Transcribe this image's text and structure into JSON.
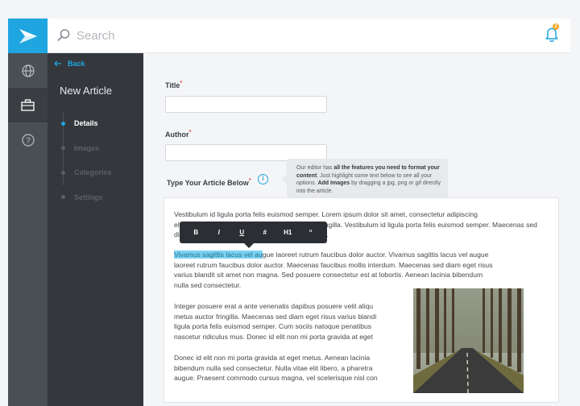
{
  "search": {
    "placeholder": "Search"
  },
  "notifications": {
    "count": "2"
  },
  "sidebar": {
    "back_label": "Back",
    "title": "New Article",
    "steps": [
      {
        "label": "Details",
        "active": true
      },
      {
        "label": "Images",
        "active": false
      },
      {
        "label": "Categories",
        "active": false
      },
      {
        "label": "Settings",
        "active": false
      }
    ]
  },
  "form": {
    "title_label": "Title",
    "author_label": "Author",
    "article_label": "Type Your Article Below",
    "required_mark": "*",
    "title_value": "",
    "author_value": ""
  },
  "tooltip": {
    "part1": "Our editor has ",
    "bold1": "all the features you need to format your content",
    "part2": ". Just highlight some text below to see all your options. ",
    "bold2": "Add Images",
    "part3": " by dragging a jpg, png or gif directly into the article."
  },
  "format_toolbar": [
    "B",
    "I",
    "U",
    "#",
    "H1",
    "“"
  ],
  "editor": {
    "p1_l1": "Vestibulum id ligula porta felis euismod semper. Lorem ipsum dolor sit amet, consectetur adipiscing",
    "p1_l2": "elit. Donec ullamcorper nulla non metus auctor fringilla. Vestibulum id ligula porta felis euismod semper. Maecenas sed",
    "p1_l3": "diam eget risus varius blandit sit amet non magna.",
    "p2_highlight": "Vivamus sagittis lacus vel au",
    "p2_l1_rest": "gue laoreet rutrum faucibus dolor auctor. Vivamus sagittis lacus vel augue",
    "p2_l2": "laoreet rutrum faucibus dolor auctor. Maecenas faucibus mollis interdum. Maecenas sed diam eget risus",
    "p2_l3": "varius blandit sit amet non magna. Sed posuere consectetur est at lobortis. Aenean lacinia bibendum",
    "p2_l4": "nulla sed consectetur.",
    "p3_l1": "Integer posuere erat a ante venenatis dapibus posuere velit aliqu",
    "p3_l2": "metus auctor fringilla. Maecenas sed diam eget risus varius blandi",
    "p3_l3": "ligula porta felis euismod semper. Cum sociis natoque penatibus",
    "p3_l4": "nascetur ridiculus mus. Donec id elit non mi porta gravida at eget",
    "p4_l1": "Donec id elit non mi porta gravida at eget metus. Aenean lacinia",
    "p4_l2": "bibendum nulla sed consectetur. Nulla vitae elit libero, a pharetra",
    "p4_l3": "augue. Praesent commodo cursus magna, vel scelerisque nisl con"
  },
  "colors": {
    "accent": "#1fa5e0",
    "rail": "#4a4f55",
    "sidebar": "#34383d"
  }
}
